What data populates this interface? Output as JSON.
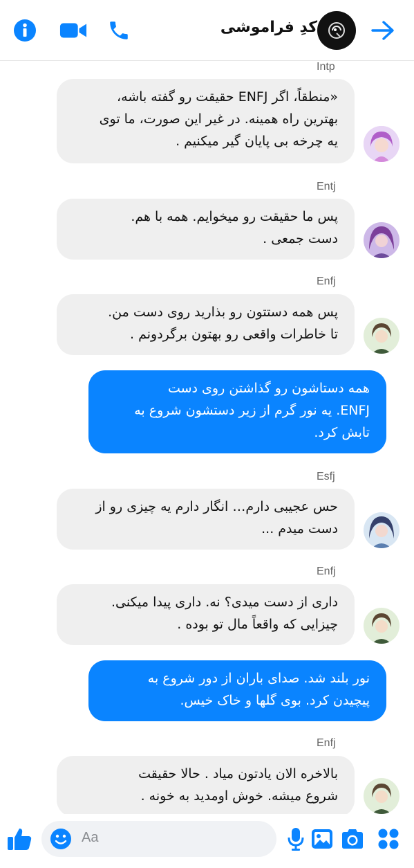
{
  "header": {
    "title": "کدِ فراموشی",
    "icons": [
      "info-icon",
      "video-call-icon",
      "phone-icon",
      "back-arrow-icon"
    ]
  },
  "colors": {
    "accent": "#0a84ff",
    "incoming_bg": "#efefef"
  },
  "messages": [
    {
      "sender": "Intp",
      "direction": "in",
      "text": "«منطقاً، اگر ENFJ حقیقت رو گفته باشه،\nبهترین راه همینه. در غیر این صورت، ما توی\nیه چرخه بی پایان گیر میکنیم ."
    },
    {
      "sender": "Entj",
      "direction": "in",
      "text": "پس ما حقیقت رو میخوایم. همه با هم.\nدست جمعی ."
    },
    {
      "sender": "Enfj",
      "direction": "in",
      "text": "پس همه دستتون رو بذارید روی دست من.\nتا خاطرات واقعی رو بهتون برگردونم ."
    },
    {
      "sender": "",
      "direction": "out",
      "text": "همه دستاشون رو گذاشتن روی دست\nENFJ. یه نور گرم از زیر دستشون شروع به\nتابش کرد."
    },
    {
      "sender": "Esfj",
      "direction": "in",
      "text": "حس عجیبی دارم… انگار دارم یه چیزی رو از\nدست میدم ..."
    },
    {
      "sender": "Enfj",
      "direction": "in",
      "text": "داری از دست میدی؟ نه. داری پیدا میکنی.\nچیزایی که واقعاً مال تو بوده ."
    },
    {
      "sender": "",
      "direction": "out",
      "text": "نور بلند شد. صدای باران از دور شروع به\nپیچیدن کرد. بوی گلها و خاک خیس."
    },
    {
      "sender": "Enfj",
      "direction": "in",
      "text": "بالاخره الان یادتون میاد . حالا حقیقت\nشروع میشه. خوش اومدید به خونه ."
    }
  ],
  "composer": {
    "placeholder": "Aa",
    "icons": [
      "like-icon",
      "emoji-icon",
      "microphone-icon",
      "gallery-icon",
      "camera-icon",
      "apps-grid-icon"
    ]
  }
}
